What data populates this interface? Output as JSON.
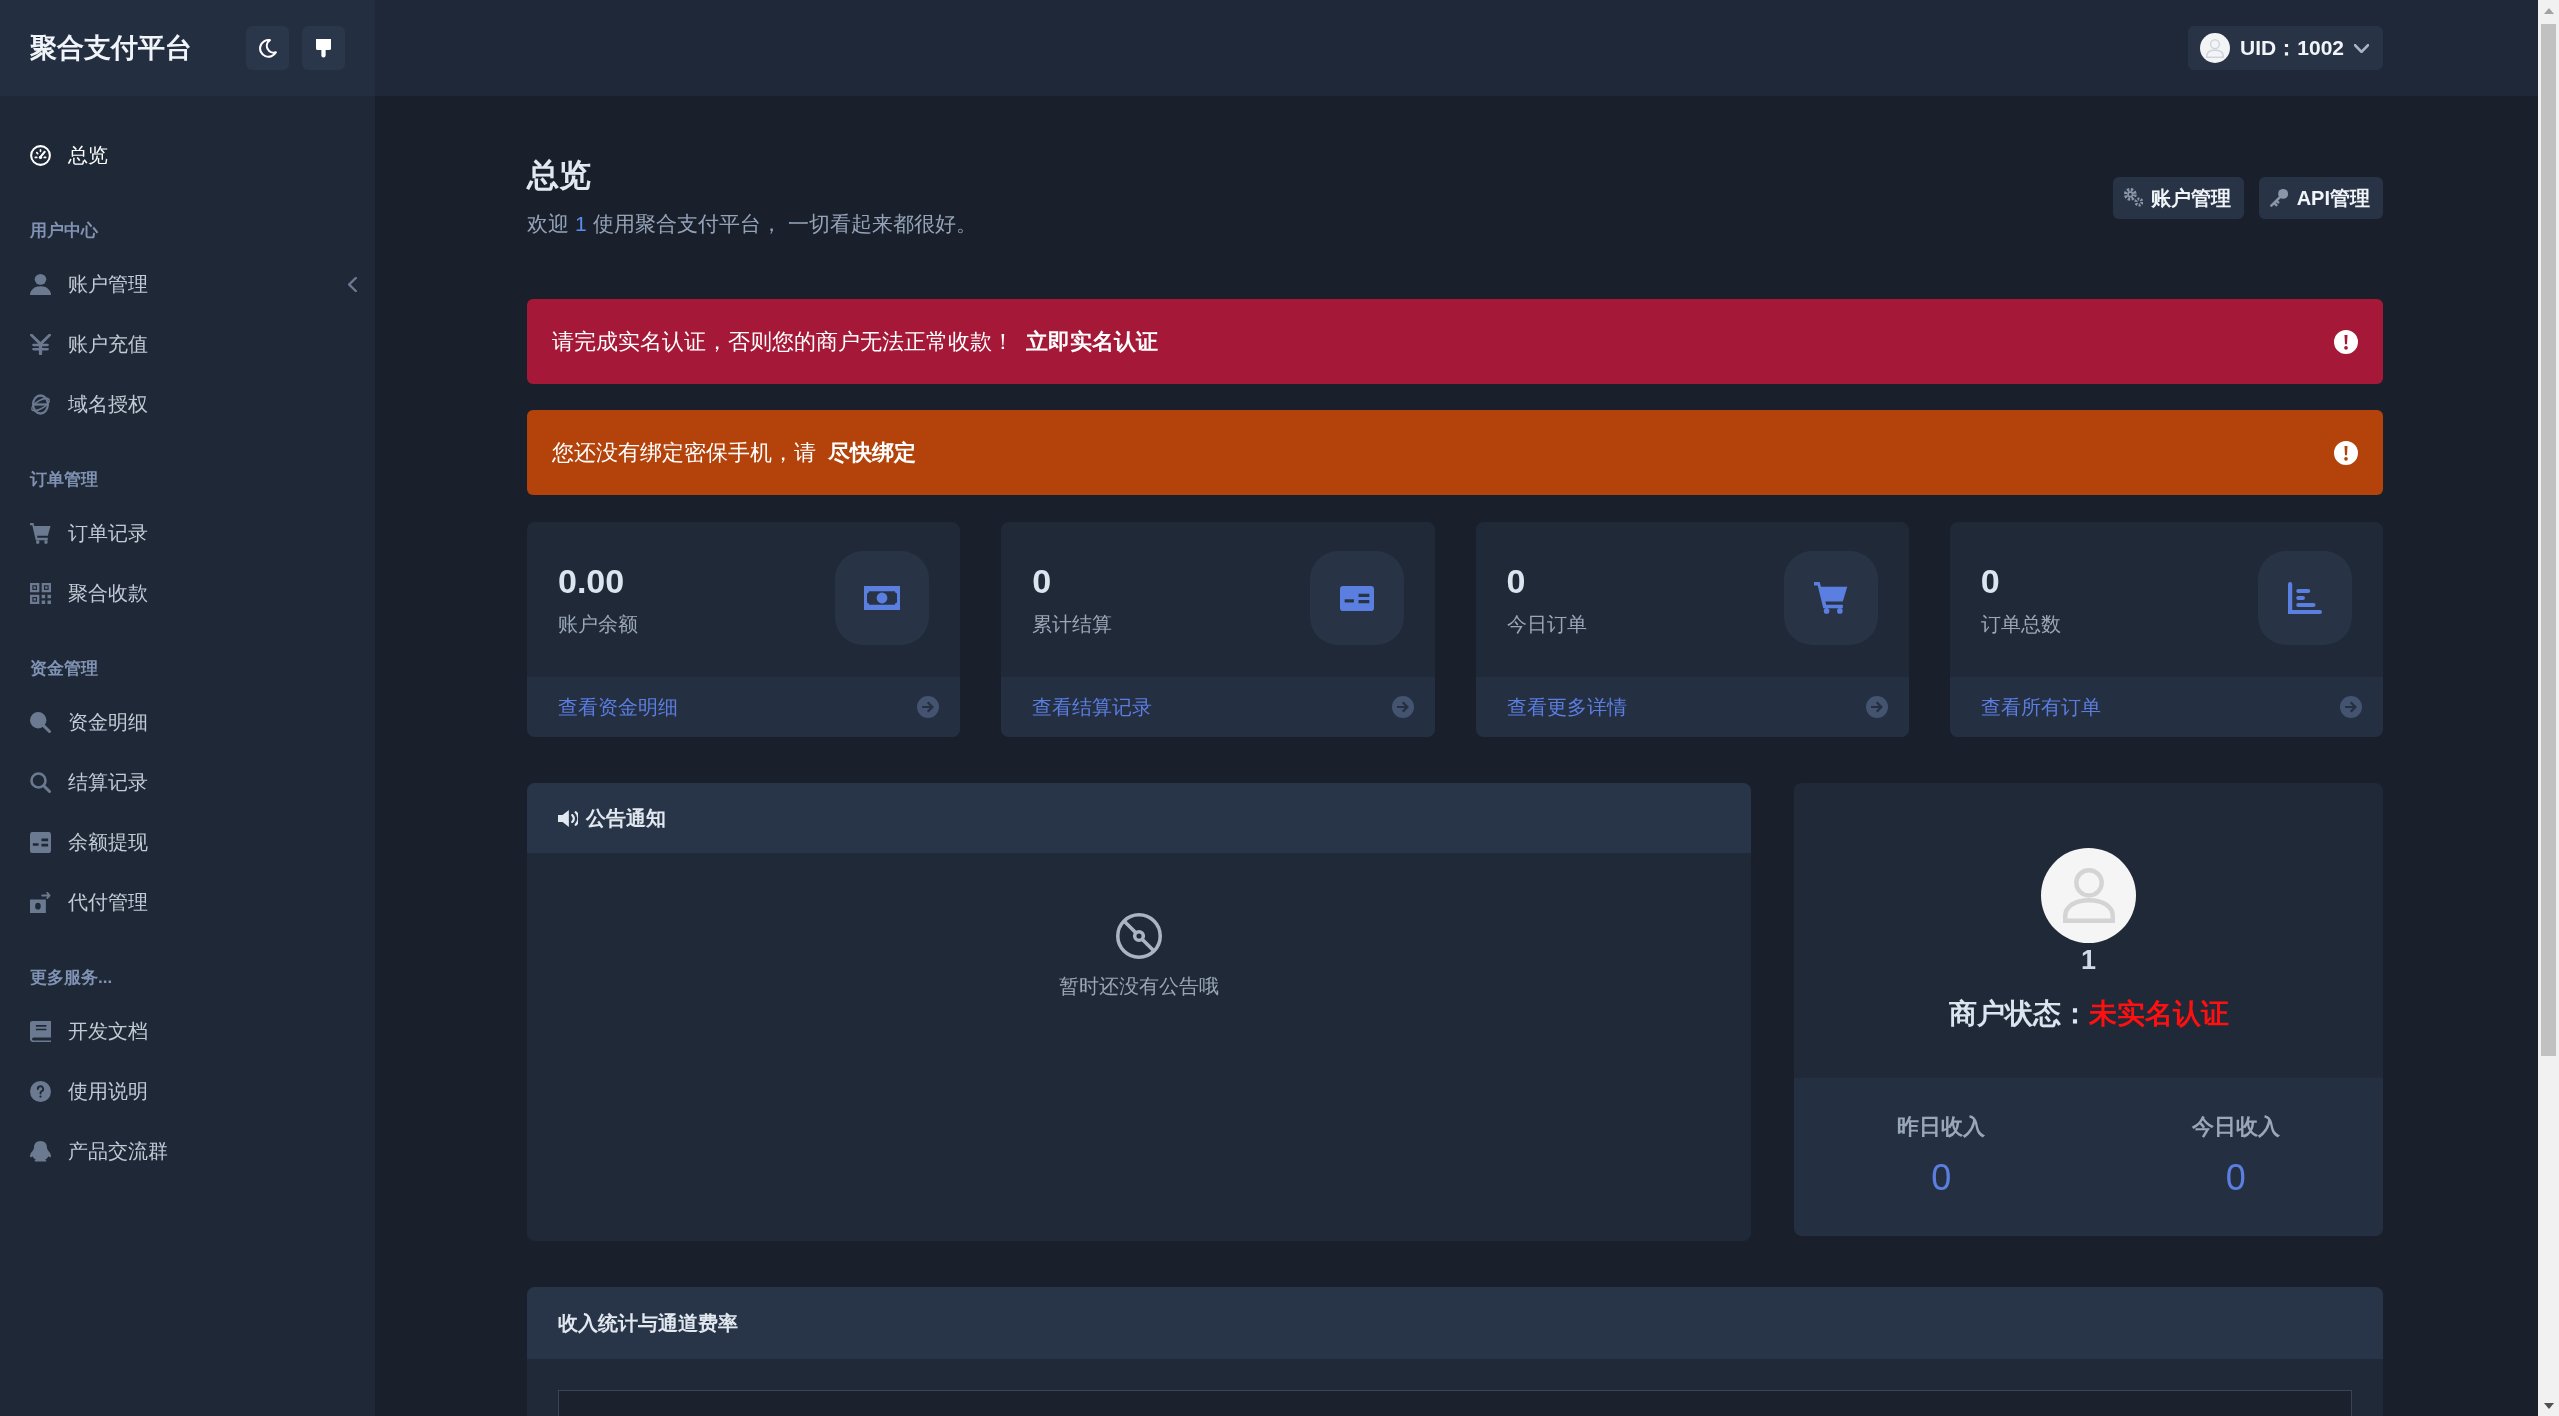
{
  "sidebar": {
    "brand": "聚合支付平台",
    "sections": [
      {
        "items": [
          {
            "label": "总览",
            "kind": "link",
            "selected": true
          }
        ]
      },
      {
        "heading": "用户中心",
        "items": [
          {
            "label": "账户管理",
            "kind": "group",
            "selected": false,
            "expanded": false
          },
          {
            "label": "账户充值",
            "kind": "link",
            "selected": false
          },
          {
            "label": "域名授权",
            "kind": "link",
            "selected": false
          }
        ]
      },
      {
        "heading": "订单管理",
        "items": [
          {
            "label": "订单记录",
            "kind": "link",
            "selected": false
          },
          {
            "label": "聚合收款",
            "kind": "link",
            "selected": false
          }
        ]
      },
      {
        "heading": "资金管理",
        "items": [
          {
            "label": "资金明细",
            "kind": "link",
            "selected": false
          },
          {
            "label": "结算记录",
            "kind": "link",
            "selected": false
          },
          {
            "label": "余额提现",
            "kind": "link",
            "selected": false
          },
          {
            "label": "代付管理",
            "kind": "link",
            "selected": false
          }
        ]
      },
      {
        "heading": "更多服务...",
        "items": [
          {
            "label": "开发文档",
            "kind": "link",
            "selected": false
          },
          {
            "label": "使用说明",
            "kind": "link",
            "selected": false
          },
          {
            "label": "产品交流群",
            "kind": "link",
            "selected": false
          }
        ]
      }
    ]
  },
  "top_bar": {
    "user_menu": {
      "label": "UID：1002"
    }
  },
  "page": {
    "title": "总览",
    "welcome_prefix": "欢迎",
    "username": "1",
    "welcome_suffix": "使用聚合支付平台， 一切看起来都很好。",
    "actions": [
      {
        "label": "账户管理"
      },
      {
        "label": "API管理"
      }
    ]
  },
  "alerts": [
    {
      "kind": "danger",
      "message": "请完成实名认证，否则您的商户无法正常收款！",
      "link": "立即实名认证"
    },
    {
      "kind": "warning",
      "message": "您还没有绑定密保手机，请",
      "link": "尽快绑定"
    }
  ],
  "stats": [
    {
      "value": "0.00",
      "label": "账户余额",
      "link": "查看资金明细"
    },
    {
      "value": "0",
      "label": "累计结算",
      "link": "查看结算记录"
    },
    {
      "value": "0",
      "label": "今日订单",
      "link": "查看更多详情"
    },
    {
      "value": "0",
      "label": "订单总数",
      "link": "查看所有订单"
    }
  ],
  "announcements": {
    "title": "公告通知",
    "empty_text": "暂时还没有公告哦"
  },
  "merchant": {
    "name": "1",
    "status_label": "商户状态：",
    "status": "未实名认证",
    "income": [
      {
        "label": "昨日收入",
        "value": "0"
      },
      {
        "label": "今日收入",
        "value": "0"
      }
    ]
  },
  "income_panel": {
    "title": "收入统计与通道费率"
  }
}
